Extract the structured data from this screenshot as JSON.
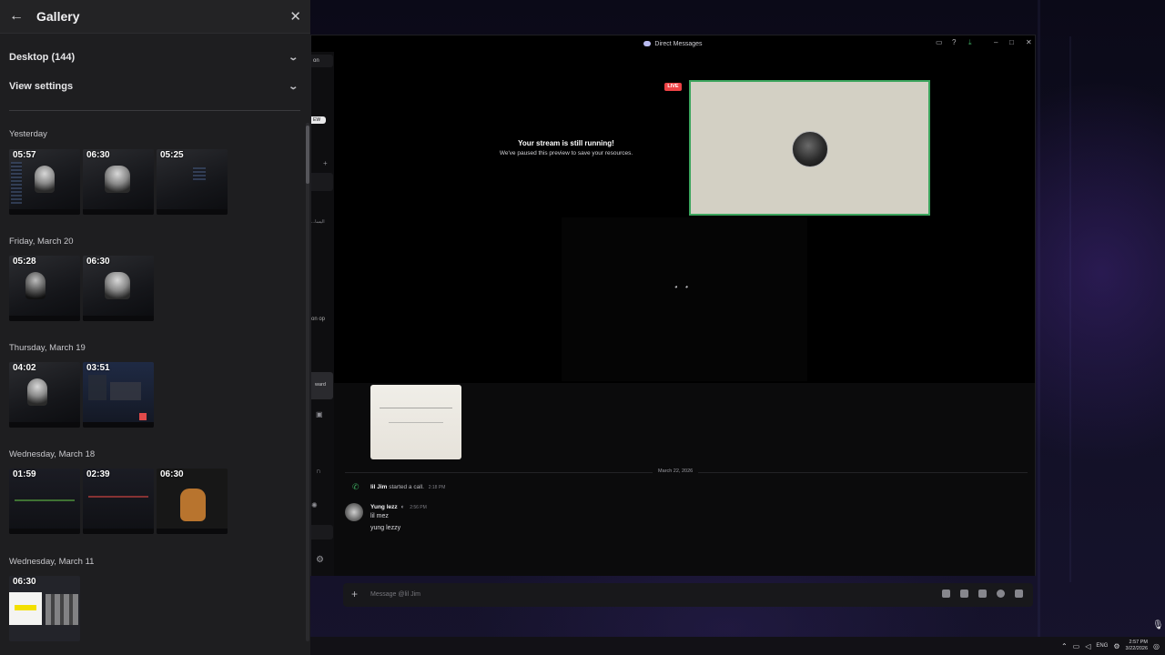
{
  "gallery": {
    "title": "Gallery",
    "back_icon": "←",
    "close_icon": "✕",
    "source_label": "Desktop (144)",
    "view_settings_label": "View settings",
    "groups": [
      {
        "label": "Yesterday",
        "durations": [
          "05:57",
          "06:30",
          "05:25"
        ]
      },
      {
        "label": "Friday, March 20",
        "durations": [
          "05:28",
          "06:30"
        ]
      },
      {
        "label": "Thursday, March 19",
        "durations": [
          "04:02",
          "03:51"
        ]
      },
      {
        "label": "Wednesday, March 18",
        "durations": [
          "01:59",
          "02:39",
          "06:30"
        ]
      },
      {
        "label": "Wednesday, March 11",
        "durations": [
          "06:30"
        ]
      }
    ]
  },
  "discord": {
    "window_title": "Direct Messages",
    "strip_labels": {
      "top_tab": "on",
      "badge": "EW",
      "arabic_snippet": "...اليسا",
      "text_op": "on op",
      "forward": "ward"
    },
    "stream": {
      "live_label": "LIVE",
      "title": "Your stream is still running!",
      "subtitle": "We've paused this preview to save your resources."
    },
    "chat": {
      "date_divider": "March 22, 2026",
      "call_user": "lil Jim",
      "call_text": "started a call.",
      "call_time": "2:18 PM",
      "author": "Yung lezz",
      "author_time": "2:56 PM",
      "messages": [
        "lil mez",
        "yung lezzy"
      ],
      "composer_placeholder": "Message @lil Jim"
    }
  },
  "taskbar": {
    "language": "ENG",
    "time": "2:57 PM",
    "date": "3/22/2026"
  }
}
